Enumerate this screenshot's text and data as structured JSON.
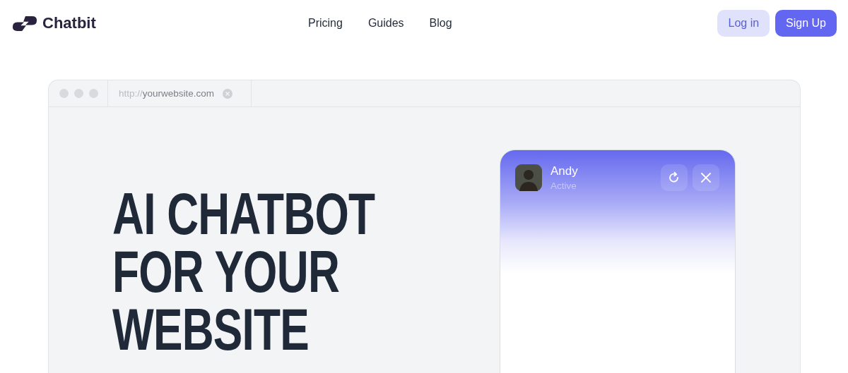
{
  "brand": {
    "name": "Chatbit"
  },
  "nav": [
    {
      "label": "Pricing"
    },
    {
      "label": "Guides"
    },
    {
      "label": "Blog"
    }
  ],
  "actions": {
    "login": "Log in",
    "signup": "Sign Up"
  },
  "browser": {
    "url_prefix": "http://",
    "url": "yourwebsite.com"
  },
  "headline": [
    "AI CHATBOT",
    "FOR YOUR",
    "WEBSITE"
  ],
  "chat": {
    "agent_name": "Andy",
    "status": "Active"
  }
}
